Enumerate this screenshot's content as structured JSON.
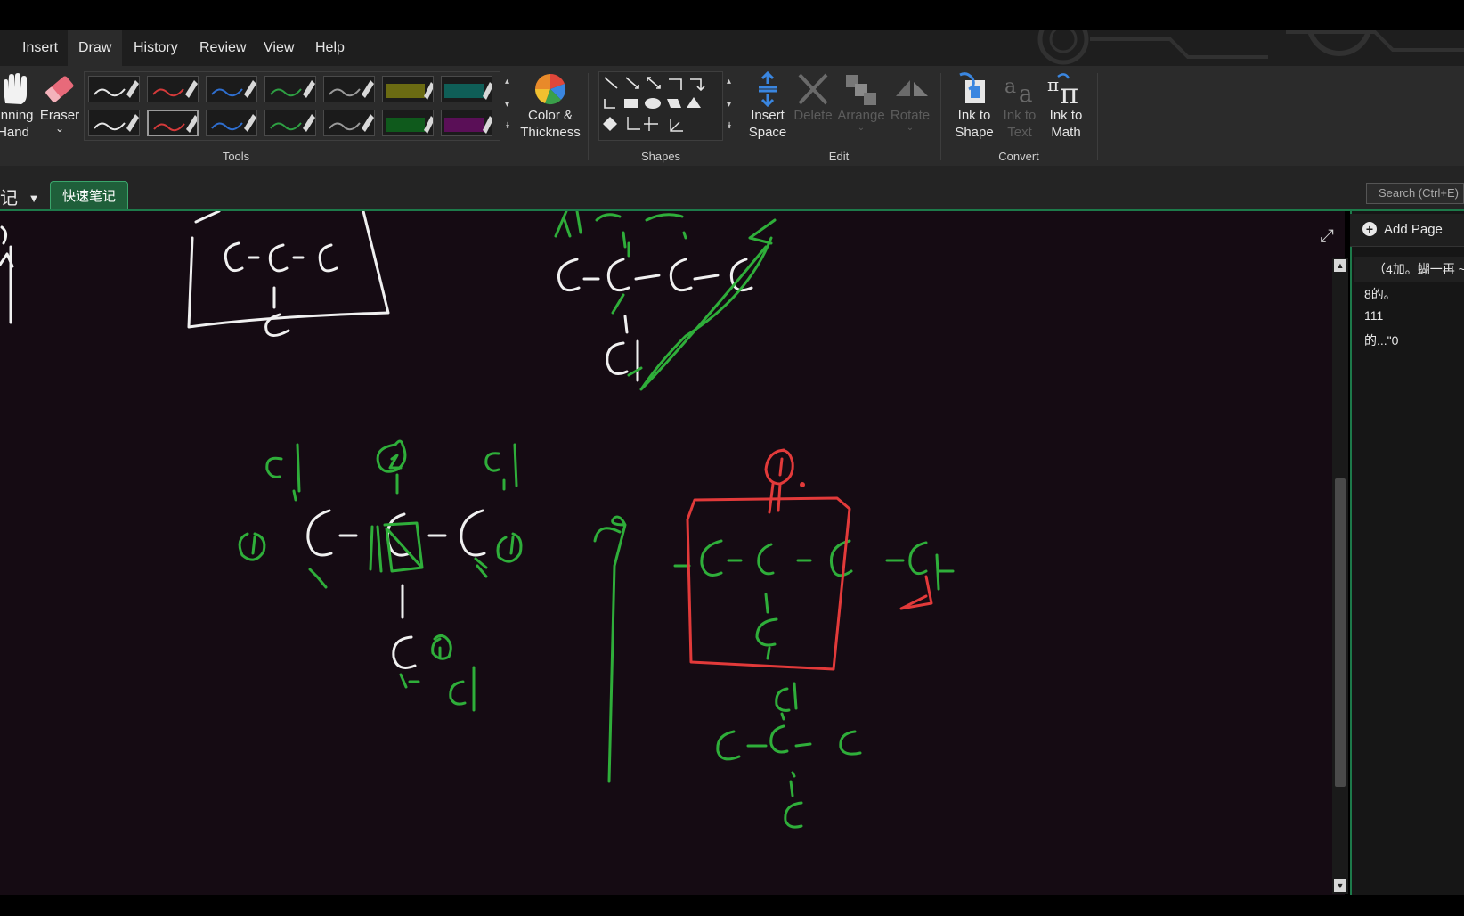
{
  "menu": {
    "tabs": [
      {
        "label": "Insert"
      },
      {
        "label": "Draw"
      },
      {
        "label": "History"
      },
      {
        "label": "Review"
      },
      {
        "label": "View"
      },
      {
        "label": "Help"
      }
    ],
    "active_tab": "Draw"
  },
  "ribbon": {
    "panning_hand": {
      "line1": "anning",
      "line2": "Hand",
      "icon": "hand-icon"
    },
    "eraser": {
      "label": "Eraser",
      "arrow": "⌄",
      "icon": "eraser-icon"
    },
    "pens": [
      {
        "color": "#e6e6e6",
        "kind": "pen"
      },
      {
        "color": "#d43a3a",
        "kind": "pen"
      },
      {
        "color": "#2f6fd0",
        "kind": "pen"
      },
      {
        "color": "#2ea043",
        "kind": "pen"
      },
      {
        "color": "#9a9a9a",
        "kind": "pen"
      },
      {
        "color": "#6b6b12",
        "kind": "highlighter"
      },
      {
        "color": "#0f5e57",
        "kind": "highlighter"
      },
      {
        "color": "#e6e6e6",
        "kind": "pen"
      },
      {
        "color": "#d43a3a",
        "kind": "pen",
        "selected": true
      },
      {
        "color": "#2f6fd0",
        "kind": "pen"
      },
      {
        "color": "#2ea043",
        "kind": "pen"
      },
      {
        "color": "#9a9a9a",
        "kind": "pen"
      },
      {
        "color": "#0f5a1c",
        "kind": "highlighter"
      },
      {
        "color": "#5a0f57",
        "kind": "highlighter"
      }
    ],
    "color_thickness": {
      "line1": "Color &",
      "line2": "Thickness",
      "icon": "color-wheel-icon"
    },
    "tools_label": "Tools",
    "shapes_label": "Shapes",
    "insert_space": {
      "line1": "Insert",
      "line2": "Space",
      "icon": "insert-space-icon"
    },
    "delete": {
      "label": "Delete",
      "icon": "delete-icon"
    },
    "arrange": {
      "label": "Arrange",
      "icon": "arrange-icon"
    },
    "rotate": {
      "label": "Rotate",
      "icon": "rotate-icon"
    },
    "edit_label": "Edit",
    "ink_to_shape": {
      "line1": "Ink to",
      "line2": "Shape",
      "icon": "ink-to-shape-icon"
    },
    "ink_to_text": {
      "line1": "Ink to",
      "line2": "Text",
      "icon": "ink-to-text-icon"
    },
    "ink_to_math": {
      "line1": "Ink to",
      "line2": "Math",
      "icon": "ink-to-math-icon"
    },
    "convert_label": "Convert"
  },
  "notebook": {
    "name_partial": "记",
    "section_tab": "快速笔记"
  },
  "search": {
    "placeholder": "Search (Ctrl+E)"
  },
  "pages": {
    "add_page": "Add Page",
    "items": [
      "（4加。蝴一再 ~",
      "8的。",
      "111",
      "的...\"0"
    ]
  },
  "canvas": {
    "ink_colors": {
      "white": "#f0f0f0",
      "green": "#2fae3a",
      "red": "#e23a3a",
      "background": "#150b13"
    }
  }
}
